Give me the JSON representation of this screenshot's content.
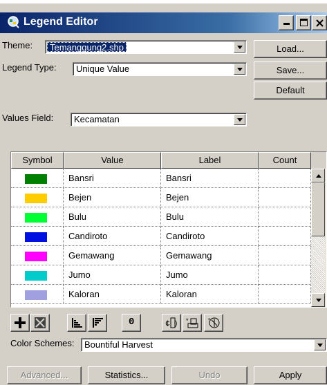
{
  "window": {
    "title": "Legend Editor"
  },
  "theme": {
    "label": "Theme:",
    "value": "Temanggung2.shp"
  },
  "legend_type": {
    "label": "Legend Type:",
    "value": "Unique Value"
  },
  "values_field": {
    "label": "Values Field:",
    "value": "Kecamatan"
  },
  "side_buttons": {
    "load": "Load...",
    "save": "Save...",
    "default": "Default"
  },
  "table": {
    "headers": {
      "symbol": "Symbol",
      "value": "Value",
      "label": "Label",
      "count": "Count"
    },
    "rows": [
      {
        "color": "#008000",
        "value": "Bansri",
        "label": "Bansri",
        "count": ""
      },
      {
        "color": "#ffcc00",
        "value": "Bejen",
        "label": "Bejen",
        "count": ""
      },
      {
        "color": "#00ff33",
        "value": "Bulu",
        "label": "Bulu",
        "count": ""
      },
      {
        "color": "#0010e0",
        "value": "Candiroto",
        "label": "Candiroto",
        "count": ""
      },
      {
        "color": "#ff00ff",
        "value": "Gemawang",
        "label": "Gemawang",
        "count": ""
      },
      {
        "color": "#00cccc",
        "value": "Jumo",
        "label": "Jumo",
        "count": ""
      },
      {
        "color": "#a0a0e0",
        "value": "Kaloran",
        "label": "Kaloran",
        "count": ""
      }
    ]
  },
  "toolbar": {
    "icons": [
      "add-icon",
      "delete-icon",
      "sort-ascending-icon",
      "sort-descending-icon",
      "zero-icon",
      "reverse-icon",
      "copy-symbol-icon",
      "paste-symbol-icon"
    ],
    "zero_label": "0"
  },
  "color_schemes": {
    "label": "Color Schemes:",
    "value": "Bountiful Harvest"
  },
  "bottom_buttons": {
    "advanced": "Advanced...",
    "statistics": "Statistics...",
    "undo": "Undo",
    "apply": "Apply"
  }
}
